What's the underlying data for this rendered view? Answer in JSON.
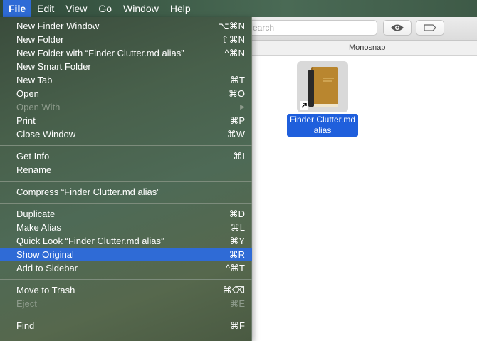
{
  "menubar": {
    "items": [
      "File",
      "Edit",
      "View",
      "Go",
      "Window",
      "Help"
    ]
  },
  "finder": {
    "search_placeholder": "Search",
    "search_visible": "earch",
    "path_title": "Monosnap",
    "file": {
      "name_line1": "Finder Clutter.md",
      "name_line2": "alias"
    }
  },
  "menu": {
    "items": [
      {
        "label": "New Finder Window",
        "shortcut": "⌥⌘N"
      },
      {
        "label": "New Folder",
        "shortcut": "⇧⌘N"
      },
      {
        "label": "New Folder with “Finder Clutter.md alias”",
        "shortcut": "^⌘N"
      },
      {
        "label": "New Smart Folder",
        "shortcut": ""
      },
      {
        "label": "New Tab",
        "shortcut": "⌘T"
      },
      {
        "label": "Open",
        "shortcut": "⌘O"
      },
      {
        "label": "Open With",
        "shortcut": "▶"
      },
      {
        "label": "Print",
        "shortcut": "⌘P"
      },
      {
        "label": "Close Window",
        "shortcut": "⌘W"
      },
      {
        "label": "Get Info",
        "shortcut": "⌘I"
      },
      {
        "label": "Rename",
        "shortcut": ""
      },
      {
        "label": "Compress “Finder Clutter.md alias”",
        "shortcut": ""
      },
      {
        "label": "Duplicate",
        "shortcut": "⌘D"
      },
      {
        "label": "Make Alias",
        "shortcut": "⌘L"
      },
      {
        "label": "Quick Look “Finder Clutter.md alias”",
        "shortcut": "⌘Y"
      },
      {
        "label": "Show Original",
        "shortcut": "⌘R"
      },
      {
        "label": "Add to Sidebar",
        "shortcut": "^⌘T"
      },
      {
        "label": "Move to Trash",
        "shortcut": "⌘⌫"
      },
      {
        "label": "Eject",
        "shortcut": "⌘E"
      },
      {
        "label": "Find",
        "shortcut": "⌘F"
      }
    ]
  },
  "colors": {
    "highlight": "#2f6bd6",
    "selection_label": "#1f5fdc"
  },
  "icons": {
    "quick_look": "eye-icon",
    "tags": "tag-icon",
    "file": "book-icon",
    "alias": "alias-arrow-icon"
  }
}
